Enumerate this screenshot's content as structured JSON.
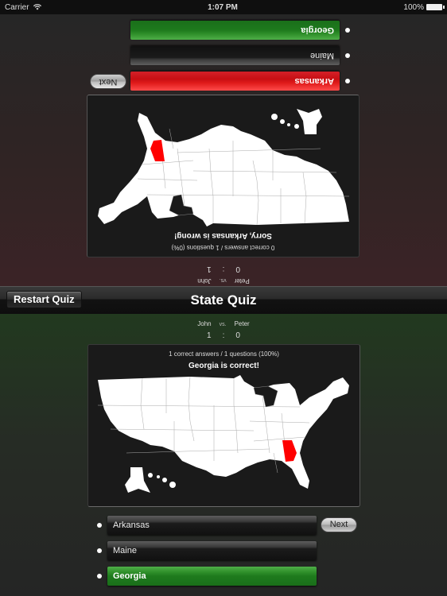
{
  "status_bar": {
    "carrier": "Carrier",
    "time": "1:07 PM",
    "battery": "100%"
  },
  "navbar": {
    "title": "State Quiz",
    "restart_label": "Restart Quiz"
  },
  "colors": {
    "correct": "#2f8f2a",
    "wrong": "#e01a1a",
    "highlight_state": "#ff0000"
  },
  "bottom_player": {
    "score": {
      "player1_name": "John",
      "vs_label": "vs.",
      "player2_name": "Peter",
      "player1_score": "1",
      "separator": ":",
      "player2_score": "0"
    },
    "stats": "1 correct answers / 1 questions (100%)",
    "result": "Georgia is correct!",
    "highlighted_state": "Georgia",
    "answers": [
      {
        "label": "Arkansas",
        "state": "neutral"
      },
      {
        "label": "Maine",
        "state": "neutral"
      },
      {
        "label": "Georgia",
        "state": "correct"
      }
    ],
    "next_label": "Next"
  },
  "top_player": {
    "orientation": "rotated 180°",
    "score": {
      "player1_name": "Peter",
      "vs_label": "vs.",
      "player2_name": "John",
      "player1_score": "0",
      "separator": ":",
      "player2_score": "1"
    },
    "stats": "0 correct answers / 1 questions (0%)",
    "result": "Sorry, Arkansas is wrong!",
    "highlighted_state": "Georgia",
    "answers": [
      {
        "label": "Arkansas",
        "state": "wrong"
      },
      {
        "label": "Maine",
        "state": "neutral"
      },
      {
        "label": "Georgia",
        "state": "correct"
      }
    ],
    "next_label": "Next"
  }
}
